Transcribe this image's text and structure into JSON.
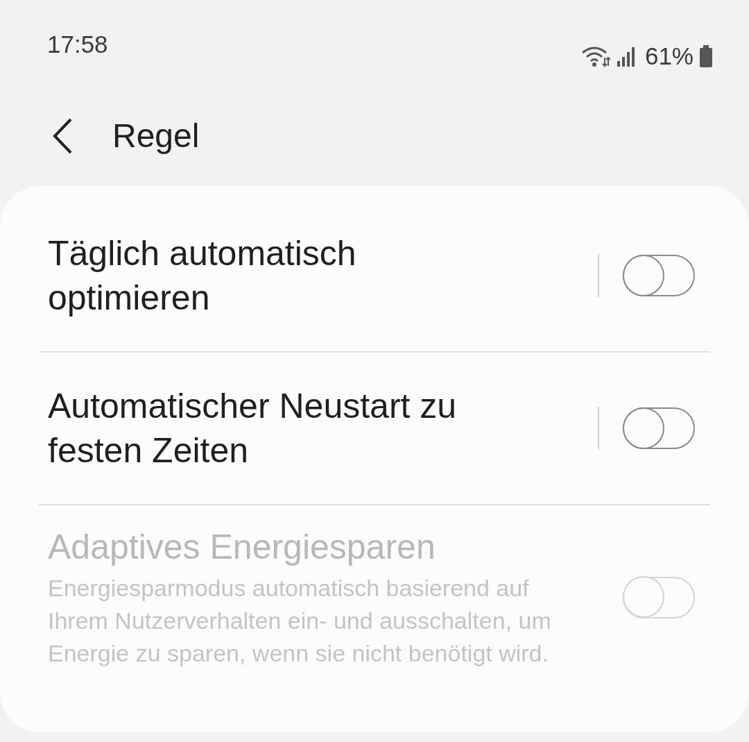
{
  "status_bar": {
    "time": "17:58",
    "battery": "61%"
  },
  "header": {
    "title": "Regel"
  },
  "settings": [
    {
      "title": "Täglich automatisch optimieren",
      "on": false,
      "disabled": false,
      "split": true
    },
    {
      "title": "Automatischer Neustart zu festen Zeiten",
      "on": false,
      "disabled": false,
      "split": true
    },
    {
      "title": "Adaptives Energiesparen",
      "description": "Energiesparmodus automatisch basierend auf Ihrem Nutzerverhalten ein- und ausschalten, um Energie zu sparen, wenn sie nicht benötigt wird.",
      "on": false,
      "disabled": true,
      "split": false
    }
  ]
}
